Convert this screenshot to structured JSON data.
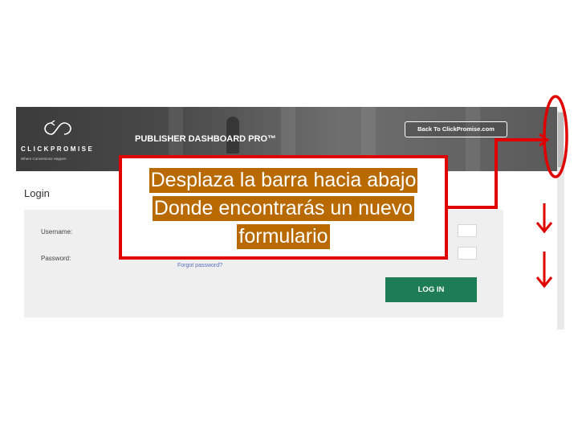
{
  "header": {
    "brand_name": "CLICKPROMISE",
    "brand_tagline": "Where Conversions Happen",
    "app_title": "PUBLISHER DASHBOARD PRO™",
    "back_button_label": "Back To ClickPromise.com"
  },
  "login": {
    "heading": "Login",
    "username_label": "Username:",
    "password_label": "Password:",
    "forgot_link": "Forgot password?",
    "submit_label": "LOG IN"
  },
  "annotation": {
    "line1": "Desplaza la barra hacia abajo",
    "line2": "Donde encontrarás un nuevo",
    "line3": "formulario",
    "highlight_color": "#b86a00",
    "border_color": "#e00000"
  },
  "colors": {
    "login_button": "#1e7d54",
    "header_background": "#4a4a4a"
  },
  "icons": {
    "logo": "infinity-arrow-icon",
    "down_arrow": "arrow-down-icon",
    "connector": "elbow-arrow-icon",
    "scroll_marker": "ellipse-marker-icon"
  }
}
